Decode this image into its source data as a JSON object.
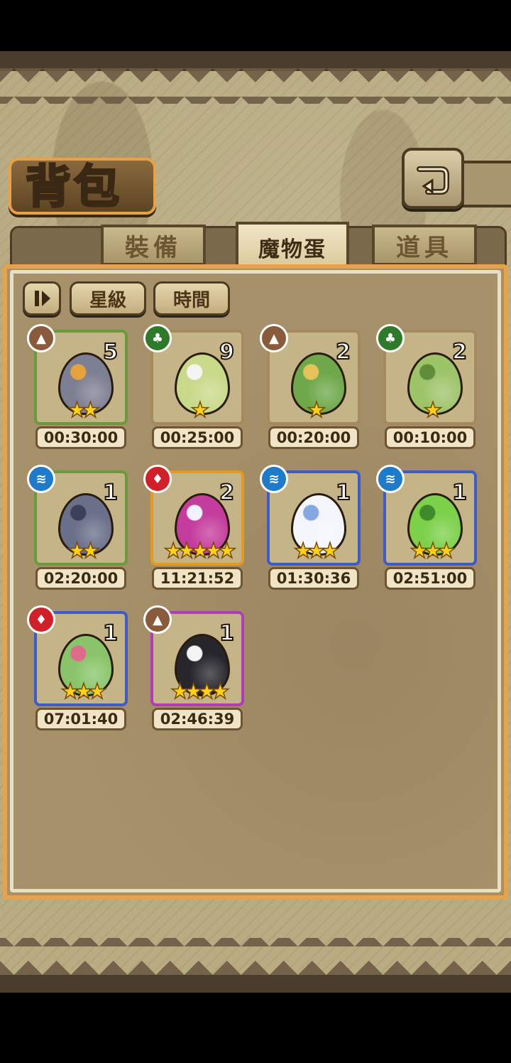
{
  "screen": {
    "title": "背包",
    "back_icon": "return-arrow-icon"
  },
  "tabs": [
    {
      "label": "裝備",
      "active": false
    },
    {
      "label": "魔物蛋",
      "active": true
    },
    {
      "label": "道具",
      "active": false
    }
  ],
  "sort": {
    "toggle_icon": "sort-order-icon",
    "star_label": "星級",
    "time_label": "時間"
  },
  "colors": {
    "panel_border": "#e8a24c",
    "frame_green": "#6a9a3c",
    "frame_orange": "#e39a1e",
    "frame_blue": "#3e5cc8",
    "frame_purple": "#b23cb8",
    "frame_tan": "#a48a5c"
  },
  "eggs": [
    {
      "element": "earth",
      "element_icon": "earth-element-icon",
      "count": "5",
      "stars": "★★",
      "timer": "00:30:00",
      "frame": "green",
      "egg_color": "#7d7f92",
      "egg_accent": "#e6a23c"
    },
    {
      "element": "wood",
      "element_icon": "wood-element-icon",
      "count": "9",
      "stars": "★",
      "timer": "00:25:00",
      "frame": "tan",
      "egg_color": "#c9d98a",
      "egg_accent": "#f4f4f0"
    },
    {
      "element": "earth",
      "element_icon": "earth-element-icon",
      "count": "2",
      "stars": "★",
      "timer": "00:20:00",
      "frame": "tan",
      "egg_color": "#6ea84a",
      "egg_accent": "#e6c25a"
    },
    {
      "element": "wood",
      "element_icon": "wood-element-icon",
      "count": "2",
      "stars": "★",
      "timer": "00:10:00",
      "frame": "tan",
      "egg_color": "#9ec46a",
      "egg_accent": "#5f8d3c"
    },
    {
      "element": "water",
      "element_icon": "water-element-icon",
      "count": "1",
      "stars": "★★",
      "timer": "02:20:00",
      "frame": "green",
      "egg_color": "#6a6f8a",
      "egg_accent": "#3c4058"
    },
    {
      "element": "fire",
      "element_icon": "fire-element-icon",
      "count": "2",
      "stars": "★★★★★",
      "timer": "11:21:52",
      "frame": "orange",
      "egg_color": "#c43c9c",
      "egg_accent": "#f2f2ff"
    },
    {
      "element": "water",
      "element_icon": "water-element-icon",
      "count": "1",
      "stars": "★★★",
      "timer": "01:30:36",
      "frame": "blue",
      "egg_color": "#f4f6fb",
      "egg_accent": "#86a8e0"
    },
    {
      "element": "water",
      "element_icon": "water-element-icon",
      "count": "1",
      "stars": "★★★",
      "timer": "02:51:00",
      "frame": "blue",
      "egg_color": "#7cd04a",
      "egg_accent": "#3f8a2a"
    },
    {
      "element": "fire",
      "element_icon": "fire-element-icon",
      "count": "1",
      "stars": "★★★",
      "timer": "07:01:40",
      "frame": "blue",
      "egg_color": "#8ac46a",
      "egg_accent": "#e06a8a"
    },
    {
      "element": "earth",
      "element_icon": "earth-element-icon",
      "count": "1",
      "stars": "★★★★",
      "timer": "02:46:39",
      "frame": "purple",
      "egg_color": "#26262c",
      "egg_accent": "#f4f4f4"
    }
  ]
}
